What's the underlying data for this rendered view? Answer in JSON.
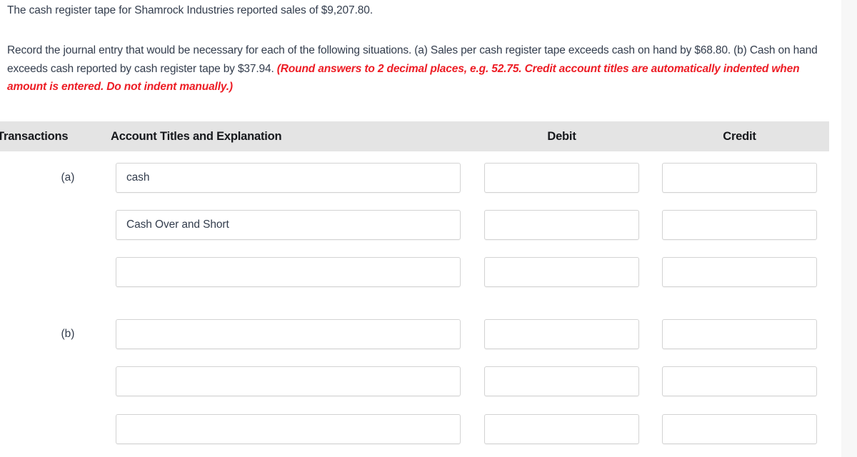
{
  "question": {
    "intro": "The cash register tape for Shamrock Industries reported sales of $9,207.80.",
    "body_plain": "Record the journal entry that would be necessary for each of the following situations. (a) Sales per cash register tape exceeds cash on hand by $68.80. (b) Cash on hand exceeds cash reported by cash register tape by $37.94. ",
    "body_hint": "(Round answers to 2 decimal places, e.g. 52.75. Credit account titles are automatically indented when amount is entered. Do not indent manually.)"
  },
  "table": {
    "headers": {
      "transactions": "Transactions",
      "account": "Account Titles and Explanation",
      "debit": "Debit",
      "credit": "Credit"
    },
    "rows": [
      {
        "transaction": "(a)",
        "account": "cash",
        "debit": "",
        "credit": ""
      },
      {
        "transaction": "",
        "account": "Cash Over and Short",
        "debit": "",
        "credit": ""
      },
      {
        "transaction": "",
        "account": "",
        "debit": "",
        "credit": ""
      },
      {
        "transaction": "(b)",
        "account": "",
        "debit": "",
        "credit": ""
      },
      {
        "transaction": "",
        "account": "",
        "debit": "",
        "credit": ""
      },
      {
        "transaction": "",
        "account": "",
        "debit": "",
        "credit": ""
      }
    ]
  },
  "colors": {
    "body_text": "#333d4d",
    "hint_red": "#ed1c24",
    "header_band": "#e4e4e4",
    "input_border": "#d3d3d3"
  }
}
